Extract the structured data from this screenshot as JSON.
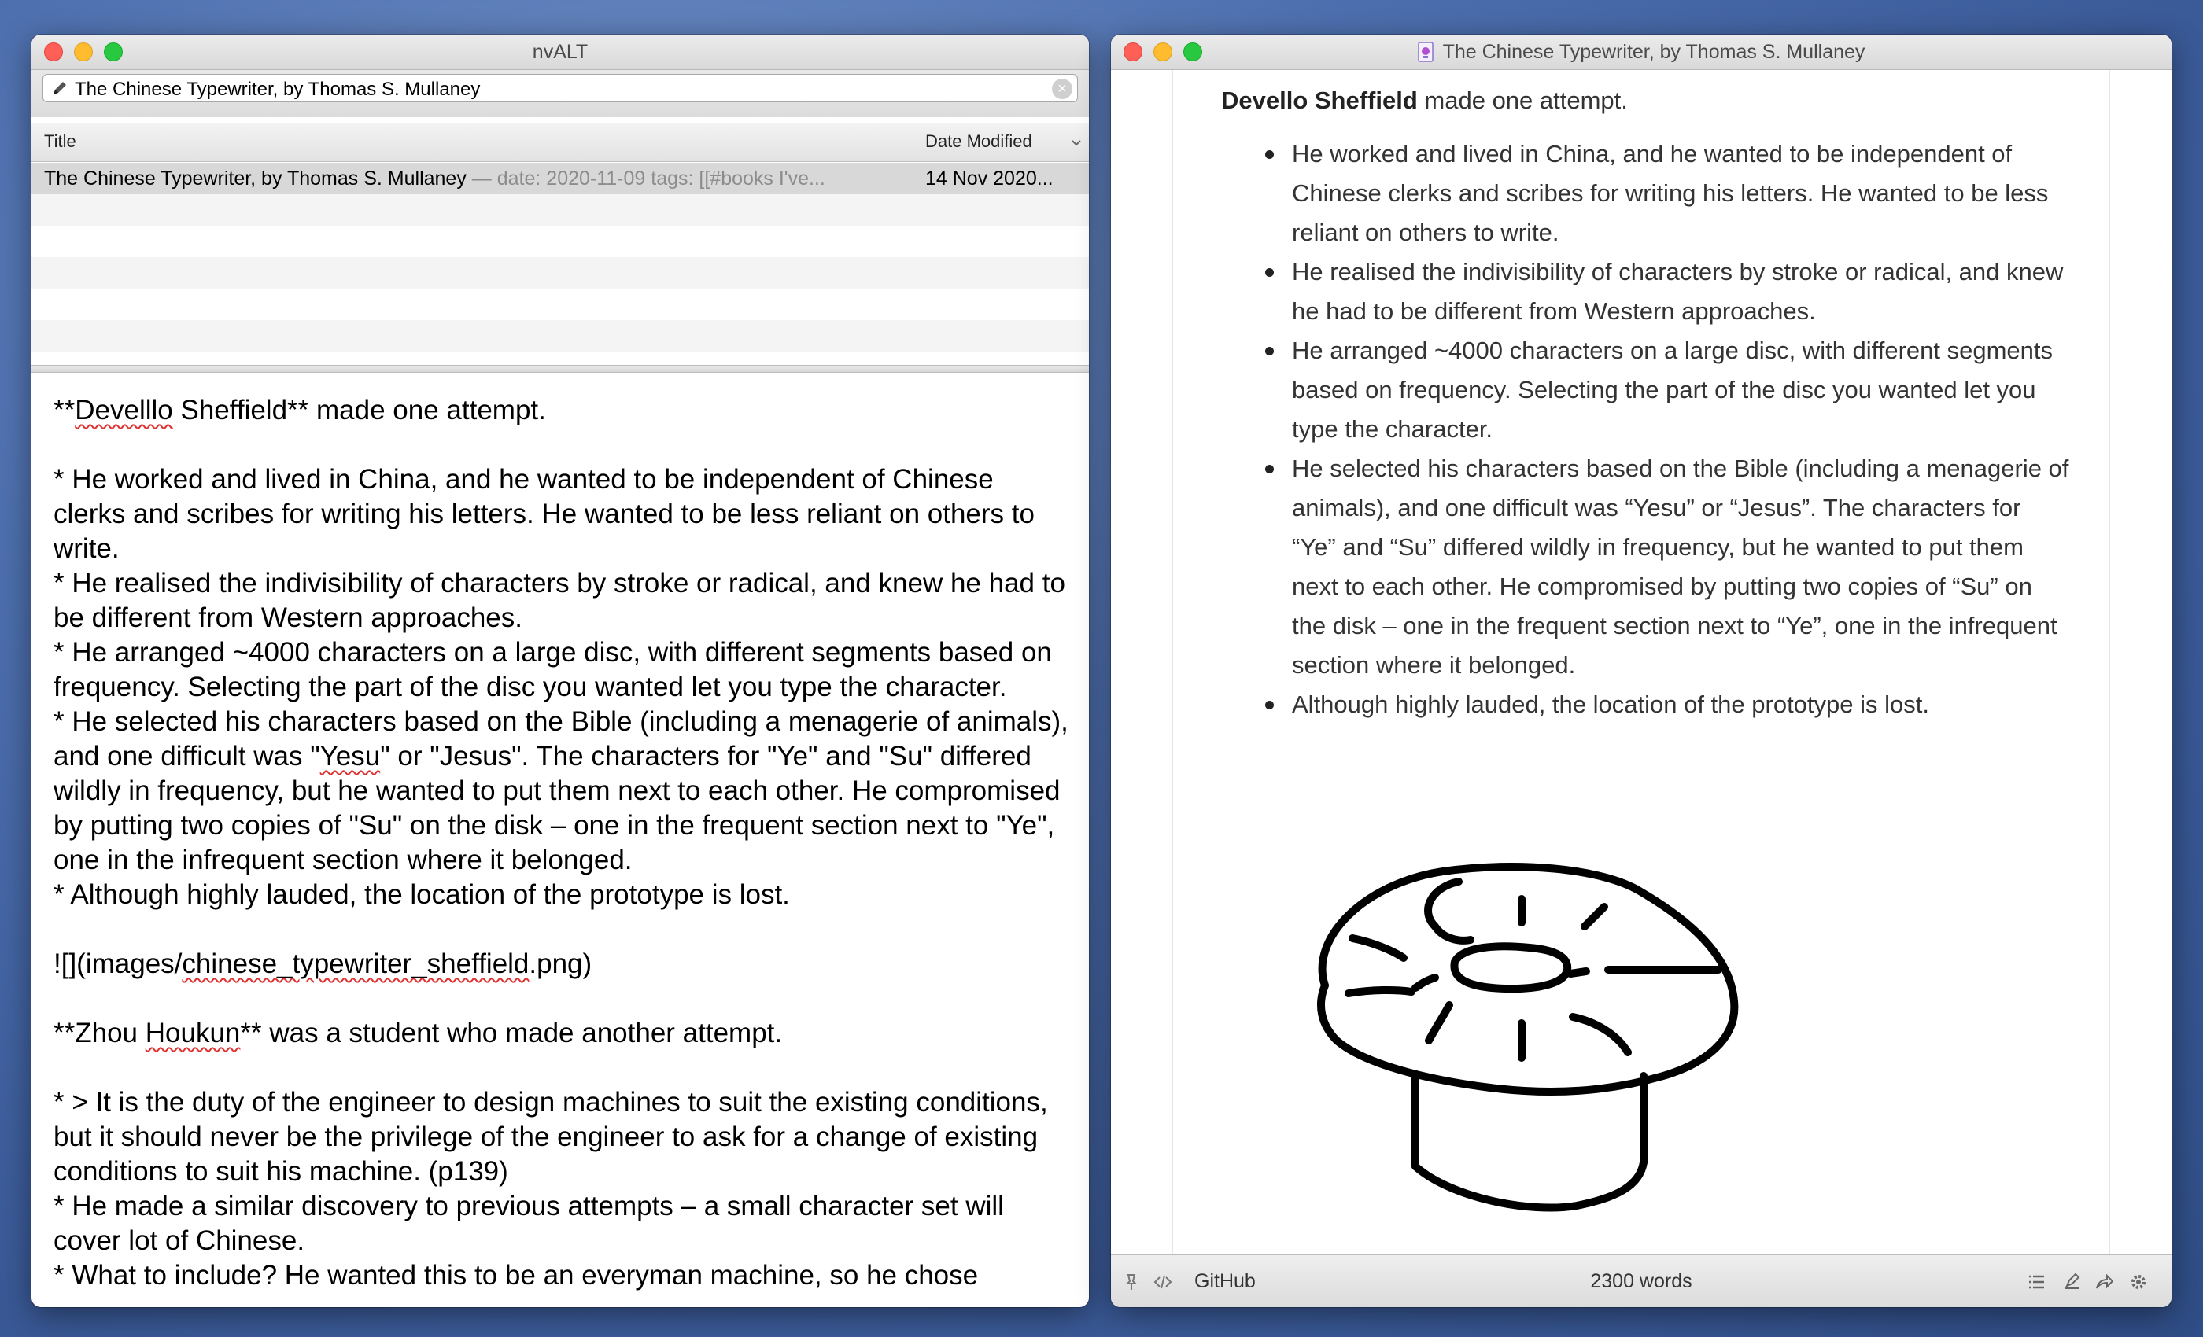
{
  "left_window": {
    "title": "nvALT",
    "search_value": "The Chinese Typewriter, by Thomas S. Mullaney",
    "columns": {
      "title": "Title",
      "date": "Date Modified"
    },
    "rows": [
      {
        "title": "The Chinese Typewriter, by Thomas S. Mullaney",
        "preview": " — date: 2020-11-09 tags: [[#books I've...",
        "date": "14 Nov 2020..."
      }
    ],
    "editor": {
      "p1_open": "**",
      "p1_w1": "Develllo",
      "p1_rest": " Sheffield** made one attempt.",
      "p2": "* He worked and lived in China, and he wanted to be independent of Chinese clerks and scribes for writing his letters. He wanted to be less reliant on others to write.",
      "p3": "* He realised the indivisibility of characters by stroke or radical, and knew he had to be different from Western approaches.",
      "p4": "* He arranged ~4000 characters on a large disc, with different segments based on frequency. Selecting the part of the disc you wanted let you type the character.",
      "p5_a": "* He selected his characters based on the Bible (including a menagerie of animals), and one difficult was \"",
      "p5_w": "Yesu",
      "p5_b": "\" or \"Jesus\". The characters for \"Ye\" and \"Su\" differed wildly in frequency, but he wanted to put them next to each other. He compromised by putting two copies of \"Su\" on the disk – one in the frequent section next to \"Ye\", one in the infrequent section where it belonged.",
      "p6": "* Although highly lauded, the location of the prototype is lost.",
      "p7_a": "![](images/",
      "p7_w": "chinese_typewriter_sheffield",
      "p7_b": ".png)",
      "p8_a": "**Zhou ",
      "p8_w": "Houkun",
      "p8_b": "** was a student who made another attempt.",
      "p9": "* > It is the duty of the engineer to design machines to suit the existing conditions, but it should never be the privilege of the engineer to ask for a change of existing conditions to suit his machine. (p139)",
      "p10": "* He made a similar discovery to previous attempts – a small character set will cover lot of Chinese.",
      "p11": "* What to include? He wanted this to be an everyman machine, so he chose"
    }
  },
  "right_window": {
    "title": "The Chinese Typewriter, by Thomas S. Mullaney",
    "heading_bold": "Devello Sheffield",
    "heading_rest": " made one attempt.",
    "bullets": [
      "He worked and lived in China, and he wanted to be independent of Chinese clerks and scribes for writing his letters. He wanted to be less reliant on others to write.",
      "He realised the indivisibility of characters by stroke or radical, and knew he had to be different from Western approaches.",
      "He arranged ~4000 characters on a large disc, with different segments based on frequency. Selecting the part of the disc you wanted let you type the character.",
      "He selected his characters based on the Bible (including a menagerie of animals), and one difficult was “Yesu” or “Jesus”. The characters for “Ye” and “Su” differed wildly in frequency, but he wanted to put them next to each other. He compromised by putting two copies of “Su” on the disk – one in the frequent section next to “Ye”, one in the infrequent section where it belonged.",
      "Although highly lauded, the location of the prototype is lost."
    ],
    "status": {
      "github_label": "GitHub",
      "word_count": "2300 words"
    }
  },
  "icons": [
    "pencil-icon",
    "clear-search-icon",
    "chevron-down-icon",
    "document-icon",
    "pin-icon",
    "code-icon",
    "list-icon",
    "highlighter-icon",
    "share-icon",
    "gear-icon"
  ],
  "colors": {
    "close": "#fe5f57",
    "minimize": "#febc2e",
    "maximize": "#28c840",
    "spellcheck": "#e03030"
  }
}
